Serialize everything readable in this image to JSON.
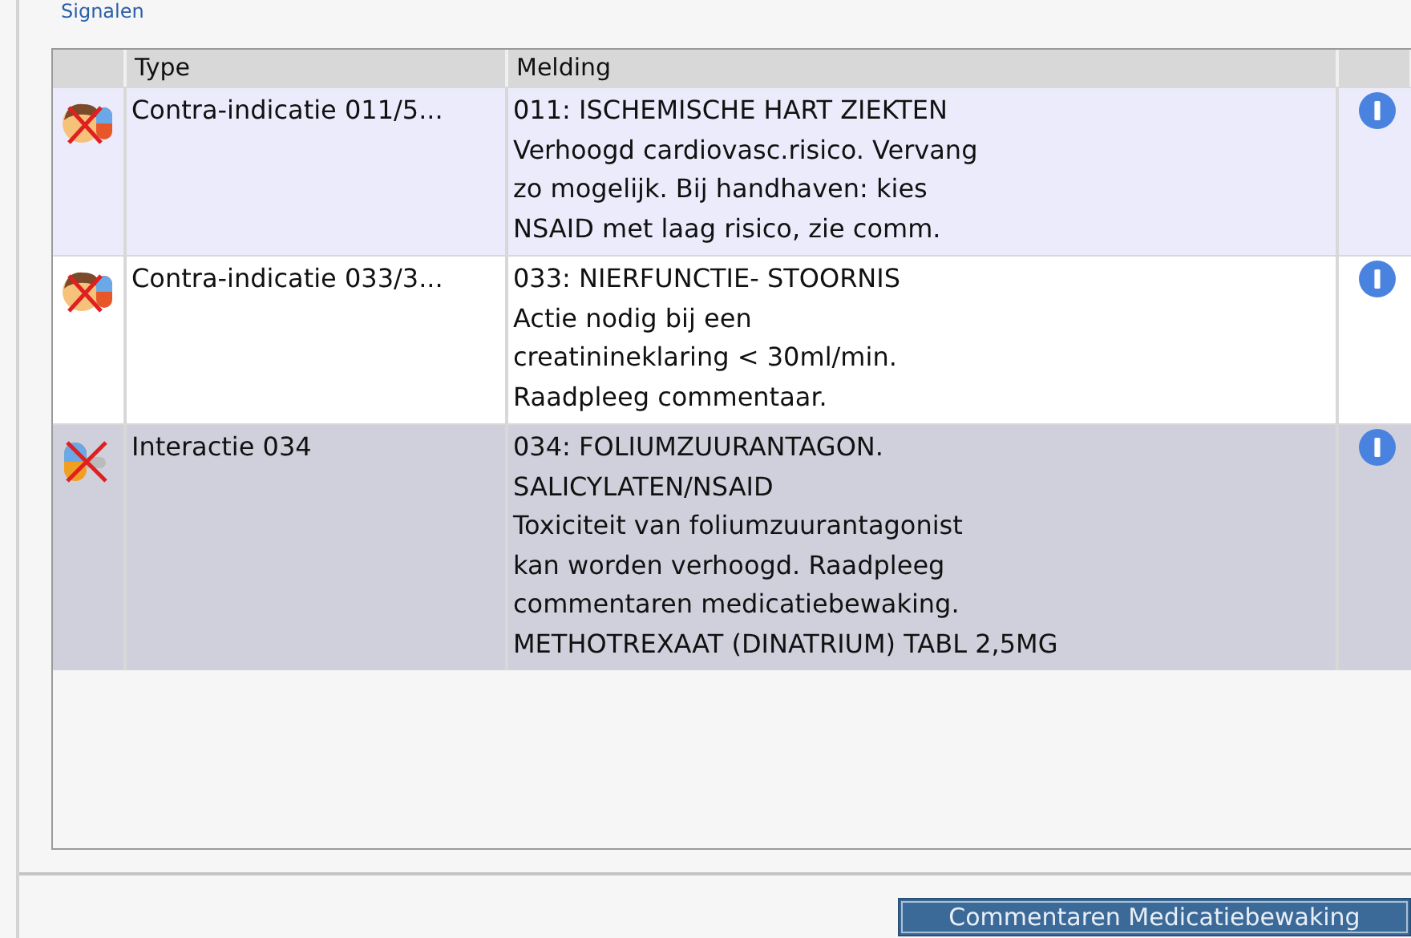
{
  "section_link": "Signalen",
  "table": {
    "columns": [
      "Type",
      "Melding"
    ],
    "rows": [
      {
        "kind": "contra-indicatie",
        "type": "Contra-indicatie 011/5...",
        "selected": false,
        "melding": [
          "011: ISCHEMISCHE HART ZIEKTEN",
          "Verhoogd cardiovasc.risico. Vervang",
          "zo mogelijk. Bij handhaven: kies",
          "NSAID met laag risico, zie comm."
        ]
      },
      {
        "kind": "contra-indicatie",
        "type": "Contra-indicatie 033/3...",
        "selected": false,
        "melding": [
          "033: NIERFUNCTIE- STOORNIS",
          "Actie nodig bij een",
          "creatinineklaring < 30ml/min.",
          "Raadpleeg commentaar."
        ]
      },
      {
        "kind": "interactie",
        "type": "Interactie 034",
        "selected": true,
        "melding": [
          "034: FOLIUMZUURANTAGON.",
          "SALICYLATEN/NSAID",
          "Toxiciteit van foliumzuurantagonist",
          "kan worden verhoogd. Raadpleeg",
          "commentaren medicatiebewaking.",
          "METHOTREXAAT (DINATRIUM) TABL 2,5MG"
        ]
      }
    ]
  },
  "button": "Commentaren Medicatiebewaking"
}
